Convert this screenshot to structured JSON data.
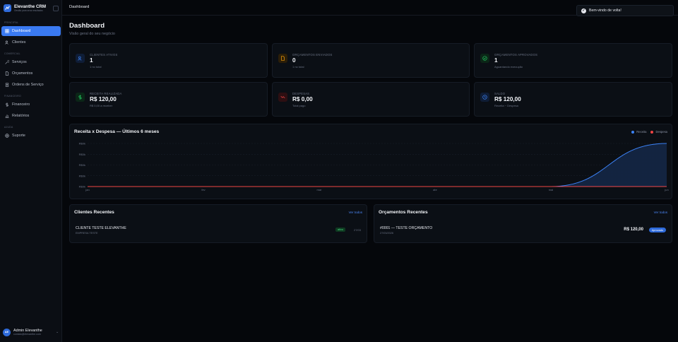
{
  "brand": {
    "name": "Elevanthe CRM",
    "subtitle": "Gestão para seus resultados"
  },
  "nav": {
    "sections": {
      "principal": "Principal",
      "comercial": "Comercial",
      "financeiro": "Financeiro",
      "ajuda": "Ajuda"
    },
    "items": [
      {
        "label": "Dashboard",
        "icon": "dashboard-icon"
      },
      {
        "label": "Clientes",
        "icon": "users-icon"
      },
      {
        "label": "Serviços",
        "icon": "wrench-icon"
      },
      {
        "label": "Orçamentos",
        "icon": "file-icon"
      },
      {
        "label": "Ordens de Serviço",
        "icon": "clipboard-icon"
      },
      {
        "label": "Financeiro",
        "icon": "dollar-icon"
      },
      {
        "label": "Relatórios",
        "icon": "chart-icon"
      },
      {
        "label": "Suporte",
        "icon": "lifebuoy-icon"
      }
    ]
  },
  "user": {
    "initials": "AE",
    "name": "Admin Elevanthe",
    "email": "contato@elevanthe.com"
  },
  "topbar": {
    "breadcrumb": "Dashboard"
  },
  "toast": {
    "message": "Bem-vindo de volta!"
  },
  "page": {
    "title": "Dashboard",
    "subtitle": "Visão geral do seu negócio"
  },
  "stats": [
    {
      "label": "Clientes ativos",
      "value": "1",
      "hint": "1 no total",
      "icon": "users-icon",
      "color": "#3b82f6"
    },
    {
      "label": "Orçamentos enviados",
      "value": "0",
      "hint": "1 no total",
      "icon": "file-icon",
      "color": "#f59e0b"
    },
    {
      "label": "Orçamentos aprovados",
      "value": "1",
      "hint": "Aguardando execução",
      "icon": "check-circle-icon",
      "color": "#22c55e"
    },
    {
      "label": "Receita realizada",
      "value": "R$ 120,00",
      "hint": "R$ 0,00 a receber",
      "icon": "dollar-icon",
      "color": "#22c55e"
    },
    {
      "label": "Despesas",
      "value": "R$ 0,00",
      "hint": "Total pago",
      "icon": "trending-down-icon",
      "color": "#ef4444"
    },
    {
      "label": "Saldo",
      "value": "R$ 120,00",
      "hint": "Receita − Despesa",
      "icon": "clock-icon",
      "color": "#3b82f6"
    }
  ],
  "chart": {
    "title": "Receita x Despesa — Últimos 6 meses",
    "legend": [
      "Receita",
      "Despesa"
    ]
  },
  "chart_data": {
    "type": "area",
    "title": "Receita x Despesa — Últimos 6 meses",
    "categories": [
      "jan",
      "fev",
      "mar",
      "abr",
      "mai",
      "jun"
    ],
    "series": [
      {
        "name": "Receita",
        "values": [
          0,
          0,
          0,
          0,
          0,
          120
        ],
        "color": "#3b82f6"
      },
      {
        "name": "Despesa",
        "values": [
          0,
          0,
          0,
          0,
          0,
          0
        ],
        "color": "#ef4444"
      }
    ],
    "y_ticks": [
      "R$0k",
      "R$0k",
      "R$0k",
      "R$0k",
      "R$0k"
    ],
    "ylim": [
      0,
      120
    ],
    "grid": true,
    "legend_position": "top-right"
  },
  "recent_clients": {
    "title": "Clientes Recentes",
    "see_all": "Ver todos",
    "rows": [
      {
        "name": "CLIENTE TESTE ELEVANTHE",
        "sub": "EMPRESA TESTE",
        "badge": "ativo",
        "date": "27/03"
      }
    ]
  },
  "recent_quotes": {
    "title": "Orçamentos Recentes",
    "see_all": "Ver todos",
    "rows": [
      {
        "name": "#0001 — TESTE ORÇAMENTO",
        "date": "27/03/2026",
        "amount": "R$ 120,00",
        "status": "Aprovado"
      }
    ]
  }
}
